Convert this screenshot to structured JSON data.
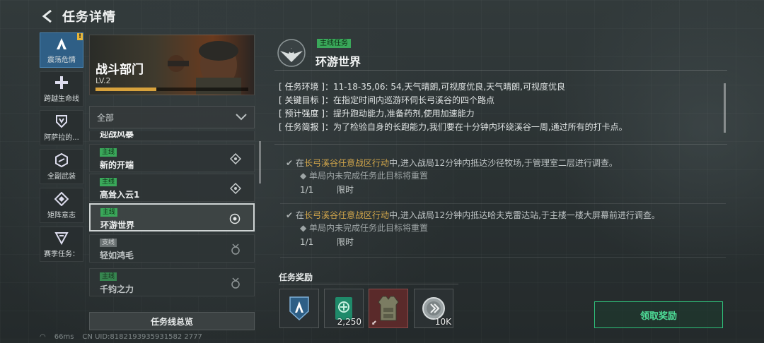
{
  "header": {
    "title": "任务详情"
  },
  "rail": {
    "items": [
      {
        "label": "震荡危情",
        "icon": "a-logo-icon",
        "active": true,
        "badge": "!"
      },
      {
        "label": "跨越生命线",
        "icon": "plus-icon"
      },
      {
        "label": "阿萨拉的...",
        "icon": "shield-icon"
      },
      {
        "label": "全副武装",
        "icon": "hex-icon"
      },
      {
        "label": "矩阵意志",
        "icon": "diamond-icon"
      },
      {
        "label": "赛季任务：",
        "icon": "triangle-icon"
      }
    ]
  },
  "faction": {
    "name": "战斗部门",
    "level": "LV.2",
    "progress": 0.4
  },
  "filter": {
    "label": "全部"
  },
  "missions": [
    {
      "tag": "",
      "name": "迎战风暴",
      "partial": true
    },
    {
      "tag": "主线",
      "name": "新的开端"
    },
    {
      "tag": "主线",
      "name": "高耸入云1"
    },
    {
      "tag": "主线",
      "name": "环游世界",
      "selected": true
    },
    {
      "tag": "支线",
      "name": "轻如鸿毛",
      "dim": true
    },
    {
      "tag": "主线",
      "name": "千钧之力",
      "dim": true
    }
  ],
  "overview_button": "任务线总览",
  "detail": {
    "tag": "主线任务",
    "title": "环游世界",
    "info": [
      {
        "key": "[ 任务环境 ]：",
        "value": "11-18-35,06: 54,天气晴朗,可视度优良,天气晴朗,可视度优良"
      },
      {
        "key": "[ 关键目标 ]：",
        "value": "在指定时间内巡游环伺长弓溪谷的四个路点"
      },
      {
        "key": "[ 预计强度 ]：",
        "value": "提升跑动能力,准备药剂,使用加速能力"
      },
      {
        "key": "[ 任务简报 ]：",
        "value": "为了检验自身的长跑能力,我们要在十分钟内环绕溪谷一周,通过所有的打卡点。"
      }
    ],
    "objectives": [
      {
        "pre": "在",
        "highlight": "长弓溪谷任意战区行动",
        "post": "中,进入战局12分钟内抵达沙径牧场,于管理室二层进行调查。",
        "warning": "单局内未完成任务此目标将重置",
        "progress": "1/1",
        "limit": "限时"
      },
      {
        "pre": "在",
        "highlight": "长弓溪谷任意战区行动",
        "post": "中,进入战局12分钟内抵达哈夫克雷达站,于主楼一楼大屏幕前进行调查。",
        "warning": "单局内未完成任务此目标将重置",
        "progress": "1/1",
        "limit": "限时"
      }
    ]
  },
  "rewards": {
    "label": "任务奖励",
    "items": [
      {
        "icon": "faction-badge-icon",
        "qty": ""
      },
      {
        "icon": "xp-card-icon",
        "qty": "2,250"
      },
      {
        "icon": "body-armor-icon",
        "qty": ""
      },
      {
        "icon": "coin-icon",
        "qty": "10K"
      }
    ]
  },
  "claim_button": "领取奖励",
  "status": {
    "ping": "66ms",
    "uid": "CN UID:8182193935931582 2777"
  },
  "colors": {
    "accent_green": "#2fbf7a",
    "tag_green": "#3aa85a",
    "highlight": "#d2a64b",
    "active_blue": "#2f5f86"
  }
}
